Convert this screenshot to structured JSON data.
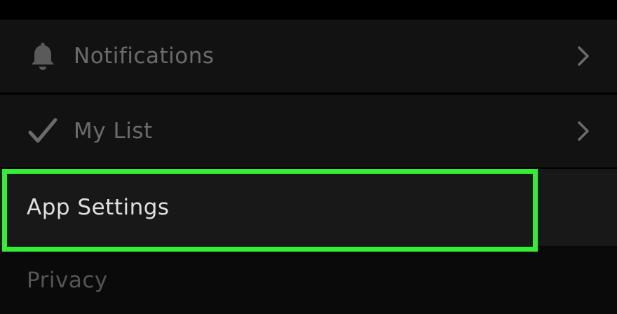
{
  "menu": {
    "items": [
      {
        "label": "Notifications",
        "icon": "bell-icon",
        "has_chevron": true
      },
      {
        "label": "My List",
        "icon": "checkmark-icon",
        "has_chevron": true
      },
      {
        "label": "App Settings",
        "highlighted": true
      },
      {
        "label": "Privacy"
      }
    ]
  },
  "colors": {
    "background": "#000000",
    "row_background": "#121212",
    "highlight_border": "#33ee33",
    "dim_text": "#6b6b6b",
    "active_text": "#e0e0e0"
  }
}
